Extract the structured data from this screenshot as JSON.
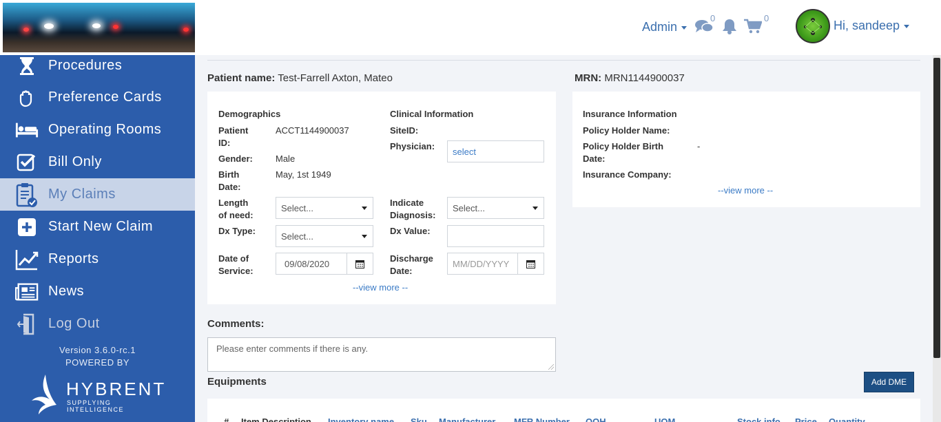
{
  "sidebar": {
    "items": [
      {
        "label": "Procedures",
        "icon": "hourglass-icon"
      },
      {
        "label": "Preference Cards",
        "icon": "hand-icon"
      },
      {
        "label": "Operating Rooms",
        "icon": "bed-icon"
      },
      {
        "label": "Bill Only",
        "icon": "checkbox-icon"
      },
      {
        "label": "My Claims",
        "icon": "clipboard-check-icon"
      },
      {
        "label": "Start New Claim",
        "icon": "plus-square-icon"
      },
      {
        "label": "Reports",
        "icon": "line-chart-icon"
      },
      {
        "label": "News",
        "icon": "newspaper-icon"
      },
      {
        "label": "Log Out",
        "icon": "door-exit-icon"
      }
    ],
    "active_item": "My Claims",
    "version": "Version 3.6.0-rc.1",
    "powered_by": "POWERED BY",
    "brand_name": "HYBRENT",
    "brand_tagline": "SUPPLYING INTELLIGENCE"
  },
  "header": {
    "admin_label": "Admin",
    "messages_count": "0",
    "cart_count": "0",
    "user_greeting": "Hi, sandeep"
  },
  "patient": {
    "name_label": "Patient name:",
    "name_value": "Test-Farrell Axton, Mateo",
    "mrn_label": "MRN:",
    "mrn_value": "MRN1144900037"
  },
  "demographics": {
    "title": "Demographics",
    "patient_id_label_1": "Patient",
    "patient_id_label_2": "ID:",
    "patient_id_value": "ACCT1144900037",
    "gender_label": "Gender:",
    "gender_value": "Male",
    "birth_label_1": "Birth",
    "birth_label_2": "Date:",
    "birth_value": "May, 1st 1949",
    "length_label_1": "Length",
    "length_label_2": "of need:",
    "length_value": "Select...",
    "dx_type_label": "Dx Type:",
    "dx_type_value": "Select...",
    "dos_label_1": "Date of",
    "dos_label_2": "Service:",
    "dos_value": "09/08/2020"
  },
  "clinical": {
    "title": "Clinical Information",
    "site_label": "SiteID:",
    "physician_label": "Physician:",
    "physician_value": "select",
    "indicate_label_1": "Indicate",
    "indicate_label_2": "Diagnosis:",
    "indicate_value": "Select...",
    "dx_value_label": "Dx Value:",
    "dx_value": "",
    "discharge_label_1": "Discharge",
    "discharge_label_2": "Date:",
    "discharge_placeholder": "MM/DD/YYYY",
    "view_more": "--view more --"
  },
  "insurance": {
    "title": "Insurance Information",
    "holder_name_label": "Policy Holder Name:",
    "holder_birth_label_1": "Policy Holder Birth",
    "holder_birth_label_2": "Date:",
    "holder_birth_value": "-",
    "company_label": "Insurance Company:",
    "view_more": "--view more --"
  },
  "comments": {
    "label": "Comments:",
    "placeholder": "Please enter comments if there is any."
  },
  "equipments": {
    "label": "Equipments",
    "add_button": "Add DME",
    "columns": [
      "#",
      "Item Description",
      "Inventory name",
      "Sku",
      "Manufacturer",
      "MFR Number",
      "QOH",
      "UOM",
      "Stock info",
      "Price",
      "Quantity"
    ]
  }
}
